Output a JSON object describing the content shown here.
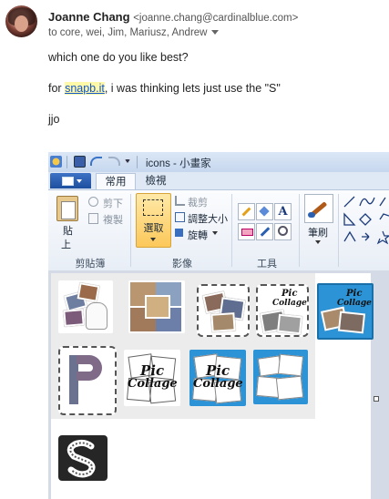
{
  "email": {
    "sender_name": "Joanne Chang",
    "sender_email": "<joanne.chang@cardinalblue.com>",
    "recipients": "to core, wei, Jim, Mariusz, Andrew",
    "line1": "which one do you like best?",
    "line2_prefix": "for ",
    "line2_link": "snapb.it",
    "line2_suffix": ", i was thinking lets just use the \"S\"",
    "signature": "jjo"
  },
  "paint": {
    "title": "icons - 小畫家",
    "tabs": [
      "常用",
      "檢視"
    ],
    "clipboard": {
      "paste": "貼",
      "paste2": "上",
      "cut": "剪下",
      "copy": "複製",
      "label": "剪貼簿"
    },
    "image": {
      "select": "選取",
      "crop": "裁剪",
      "resize": "調整大小",
      "rotate": "旋轉",
      "label": "影像"
    },
    "tools": {
      "label": "工具"
    },
    "brushes": {
      "label": "筆刷"
    },
    "icon_texts": {
      "pic": "Pic",
      "collage": "Collage"
    }
  },
  "colors": {
    "accent_blue": "#2b93d6",
    "link_blue": "#1155cc",
    "highlight": "#fff9a8"
  }
}
